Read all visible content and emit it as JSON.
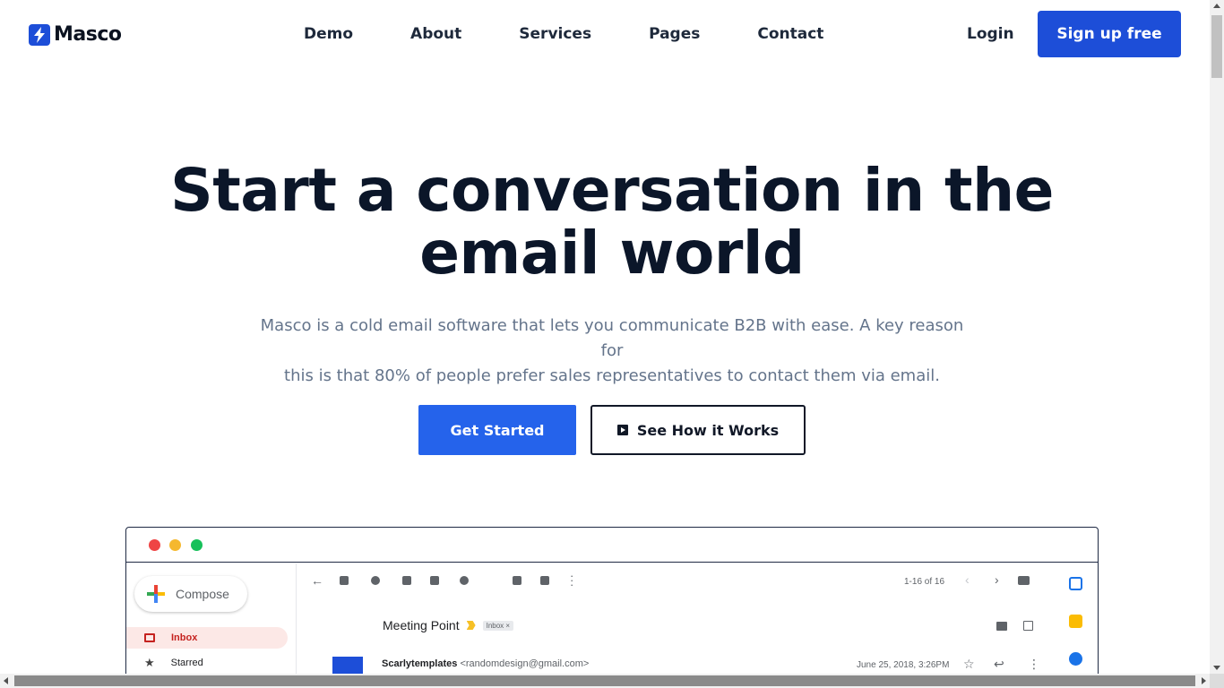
{
  "brand": {
    "name": "Masco",
    "icon": "bolt-icon",
    "color": "#1d4ed8"
  },
  "nav": {
    "items": [
      "Demo",
      "About",
      "Services",
      "Pages",
      "Contact"
    ],
    "login": "Login",
    "signup": "Sign up free"
  },
  "hero": {
    "title_line1": "Start a conversation in the",
    "title_line2": "email world",
    "subtitle_line1": "Masco is a cold email software that lets you communicate B2B with ease. A key reason for",
    "subtitle_line2": "this is that 80% of people prefer sales representatives to contact them via email.",
    "primary_cta": "Get Started",
    "secondary_cta": "See How it Works",
    "secondary_icon": "play-icon"
  },
  "mockup": {
    "compose": "Compose",
    "sidebar": {
      "inbox": "Inbox",
      "starred": "Starred"
    },
    "pager": "1-16 of 16",
    "subject": "Meeting Point",
    "tag": "Inbox ×",
    "sender_name": "Scarlytemplates",
    "sender_email": "<randomdesign@gmail.com>",
    "date": "June 25, 2018, 3:26PM"
  },
  "colors": {
    "primary": "#2563eb",
    "heading": "#0b1629",
    "muted": "#64748b"
  }
}
